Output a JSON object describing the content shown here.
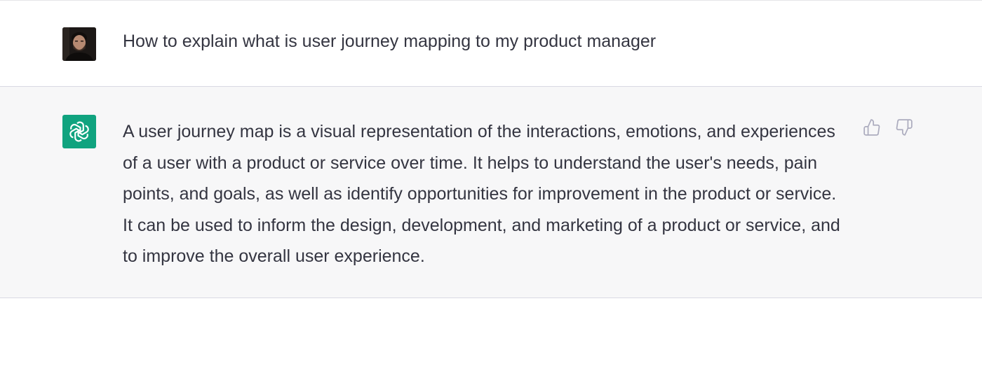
{
  "user_message": {
    "avatar_icon": "user-avatar-photo",
    "text": "How to explain what is user journey mapping to my product manager"
  },
  "assistant_message": {
    "avatar_icon": "openai-logo-icon",
    "avatar_color": "#10a37f",
    "text": "A user journey map is a visual representation of the interactions, emotions, and experiences of a user with a product or service over time. It helps to understand the user's needs, pain points, and goals, as well as identify opportunities for improvement in the product or service. It can be used to inform the design, development, and marketing of a product or service, and to improve the overall user experience."
  },
  "feedback": {
    "thumbs_up_icon": "thumbs-up-icon",
    "thumbs_down_icon": "thumbs-down-icon"
  },
  "colors": {
    "text": "#343541",
    "assistant_bg": "#f7f7f8",
    "icon_gray": "#acacbe"
  }
}
